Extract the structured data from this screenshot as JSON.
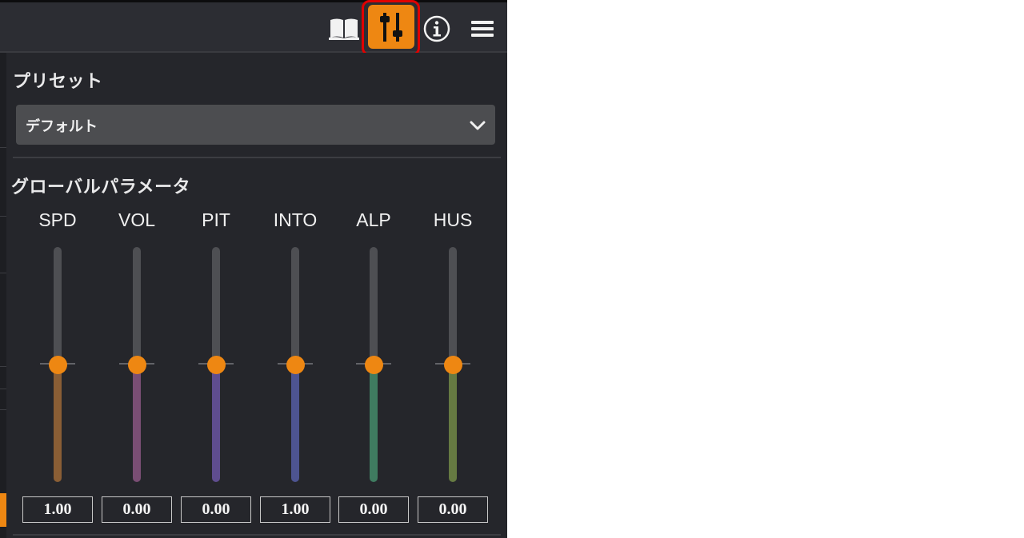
{
  "toolbar": {
    "icons": [
      "book-icon",
      "sliders-icon",
      "info-icon",
      "hamburger-menu-icon"
    ],
    "active_icon": "sliders-icon",
    "highlight_color": "#e00000",
    "accent_color": "#ee8712"
  },
  "preset": {
    "title": "プリセット",
    "selected": "デフォルト"
  },
  "global": {
    "title": "グローバルパラメータ",
    "params": [
      {
        "label": "SPD",
        "value": "1.00",
        "level": 0.5,
        "color": "#8a5e35"
      },
      {
        "label": "VOL",
        "value": "0.00",
        "level": 0.5,
        "color": "#7a4e74"
      },
      {
        "label": "PIT",
        "value": "0.00",
        "level": 0.5,
        "color": "#5f4d8f"
      },
      {
        "label": "INTO",
        "value": "1.00",
        "level": 0.5,
        "color": "#4d5491"
      },
      {
        "label": "ALP",
        "value": "0.00",
        "level": 0.5,
        "color": "#3f7b60"
      },
      {
        "label": "HUS",
        "value": "0.00",
        "level": 0.5,
        "color": "#667a42"
      }
    ]
  }
}
